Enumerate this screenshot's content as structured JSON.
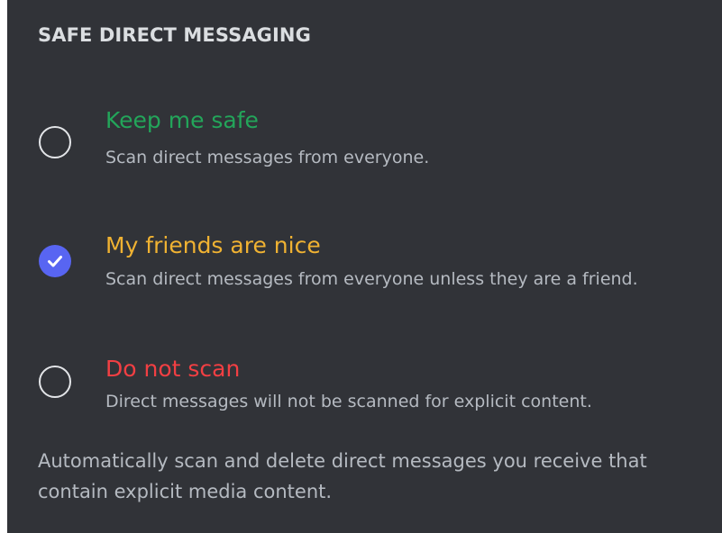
{
  "section": {
    "title": "SAFE DIRECT MESSAGING"
  },
  "options": [
    {
      "label": "Keep me safe",
      "description": "Scan direct messages from everyone.",
      "label_color": "#23a55a",
      "selected": false
    },
    {
      "label": "My friends are nice",
      "description": "Scan direct messages from everyone unless they are a friend.",
      "label_color": "#f0b232",
      "selected": true
    },
    {
      "label": "Do not scan",
      "description": "Direct messages will not be scanned for explicit content.",
      "label_color": "#f23f43",
      "selected": false
    }
  ],
  "footnote": "Automatically scan and delete direct messages you receive that contain explicit media content.",
  "colors": {
    "background": "#313338",
    "accent": "#5865f2",
    "text_primary": "#dbdee1",
    "text_secondary": "#b5bac1"
  },
  "icons": {
    "selected": "checkmark-icon"
  }
}
